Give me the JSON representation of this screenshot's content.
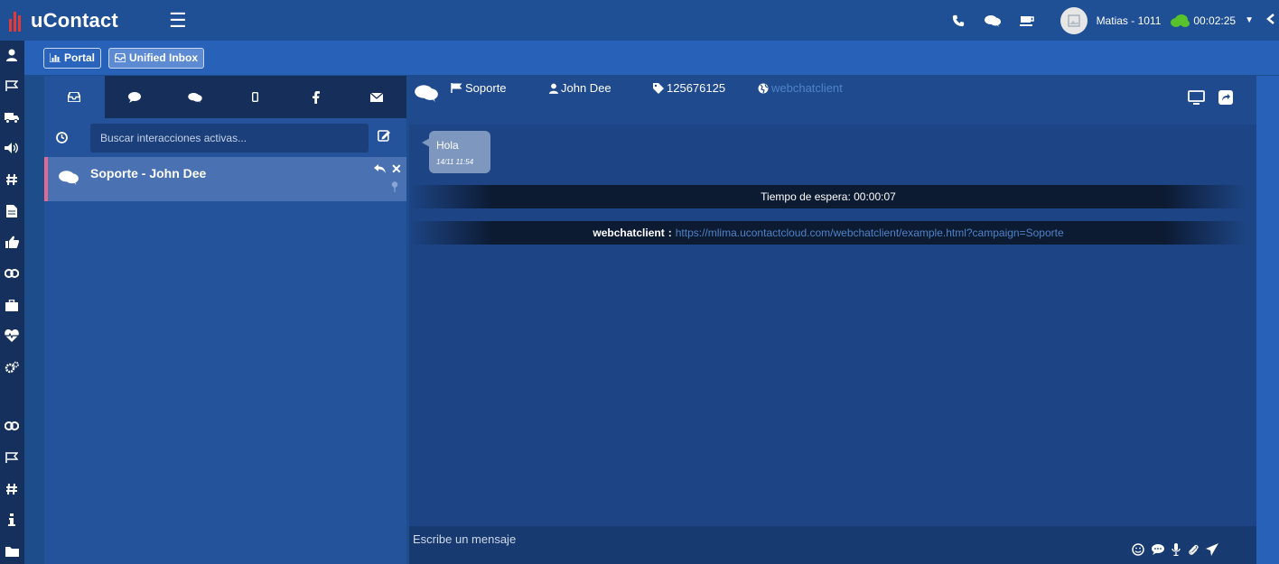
{
  "app": {
    "name": "uContact"
  },
  "topbar": {
    "user": "Matias - 1011",
    "timer": "00:02:25",
    "icons": [
      "menu-icon",
      "phone-icon",
      "chat-icon",
      "coffee-icon",
      "avatar",
      "cloud-icon",
      "caret-down-icon",
      "back-arrow-icon"
    ]
  },
  "subbar": {
    "portal_label": "Portal",
    "inbox_label": "Unified Inbox"
  },
  "sidebar": {
    "icons": [
      "user-icon",
      "flag-icon",
      "truck-icon",
      "volume-icon",
      "hashtag-icon",
      "file-icon",
      "thumbs-up-icon",
      "link-icon",
      "briefcase-icon",
      "heartbeat-icon",
      "cogs-icon",
      "link-icon",
      "flag-icon",
      "hashtag-icon",
      "info-icon",
      "folder-icon"
    ]
  },
  "inbox": {
    "tabs": [
      "inbox-icon",
      "chat-icon",
      "chats-icon",
      "mobile-icon",
      "facebook-icon",
      "envelope-icon"
    ],
    "search_placeholder": "Buscar interacciones activas...",
    "conversations": [
      {
        "title": "Soporte - John Dee"
      }
    ]
  },
  "chat": {
    "campaign": "Soporte",
    "contact": "John Dee",
    "tag": "125676125",
    "channel": "webchatclient",
    "messages": [
      {
        "text": "Hola",
        "time": "14/11 11:54"
      }
    ],
    "wait_banner": "Tiempo de espera: 00:00:07",
    "source_label": "webchatclient",
    "source_sep": ":",
    "source_url": "https://mlima.ucontactcloud.com/webchatclient/example.html?campaign=Soporte",
    "composer_placeholder": "Escribe un mensaje"
  },
  "colors": {
    "topbar": "#1f4f94",
    "sidebar": "#16305d",
    "panel": "#24529b",
    "chat_bg": "#1d4585",
    "accent_pink": "#e06b8f",
    "link": "#4f83c9",
    "logo_red": "#e53935"
  }
}
